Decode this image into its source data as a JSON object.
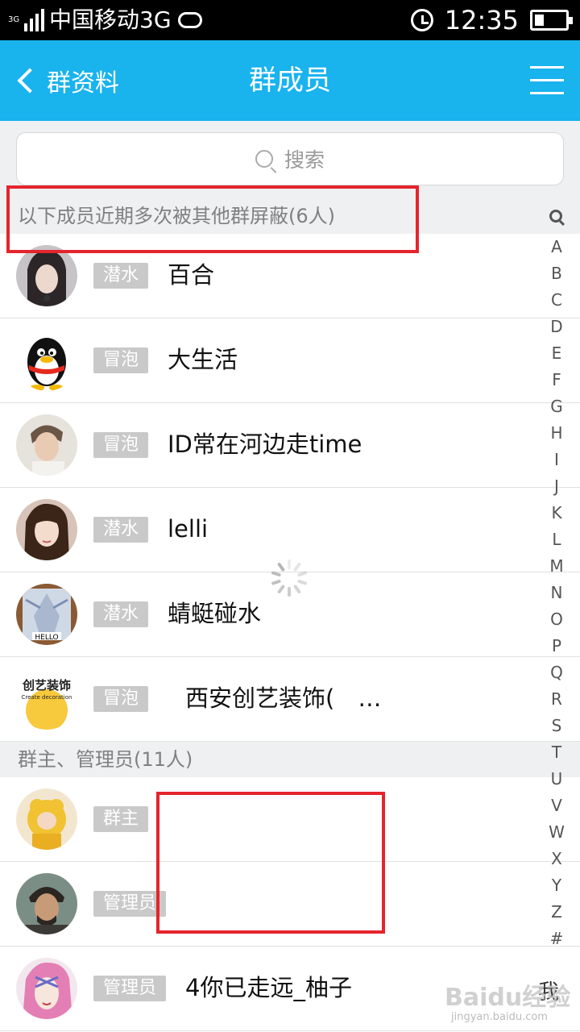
{
  "status_bar": {
    "network_type": "3G",
    "carrier": "中国移动3G",
    "time": "12:35",
    "battery_level": 0.3
  },
  "header": {
    "back_label": "群资料",
    "title": "群成员"
  },
  "search": {
    "placeholder": "搜索"
  },
  "sections": {
    "blocked_header": "以下成员近期多次被其他群屏蔽(6人)",
    "admins_header": "群主、管理员(11人)"
  },
  "blocked_members": [
    {
      "badge": "潜水",
      "name": "百合"
    },
    {
      "badge": "冒泡",
      "name": "大生活"
    },
    {
      "badge": "冒泡",
      "name": "ID常在河边走time"
    },
    {
      "badge": "潜水",
      "name": "lelli"
    },
    {
      "badge": "潜水",
      "name": "蜻蜓碰水"
    },
    {
      "badge": "冒泡",
      "name": "西安创艺装饰(　…"
    }
  ],
  "admin_members": [
    {
      "badge": "群主",
      "name": ""
    },
    {
      "badge": "管理员",
      "name": ""
    },
    {
      "badge": "管理员",
      "name": "4你已走远_柚子",
      "suffix": "我"
    }
  ],
  "avatar_texts": {
    "hello": "HELLO",
    "decor_brand": "创艺装饰",
    "decor_en": "Create decoration"
  },
  "index_letters": [
    "A",
    "B",
    "C",
    "D",
    "E",
    "F",
    "G",
    "H",
    "I",
    "J",
    "K",
    "L",
    "M",
    "N",
    "O",
    "P",
    "Q",
    "R",
    "S",
    "T",
    "U",
    "V",
    "W",
    "X",
    "Y",
    "Z",
    "#"
  ],
  "watermark": {
    "brand": "Baidu经验",
    "url": "jingyan.baidu.com"
  },
  "colors": {
    "accent": "#19b3ee",
    "annotation": "#e5242c",
    "badge": "#c9c9c9"
  }
}
